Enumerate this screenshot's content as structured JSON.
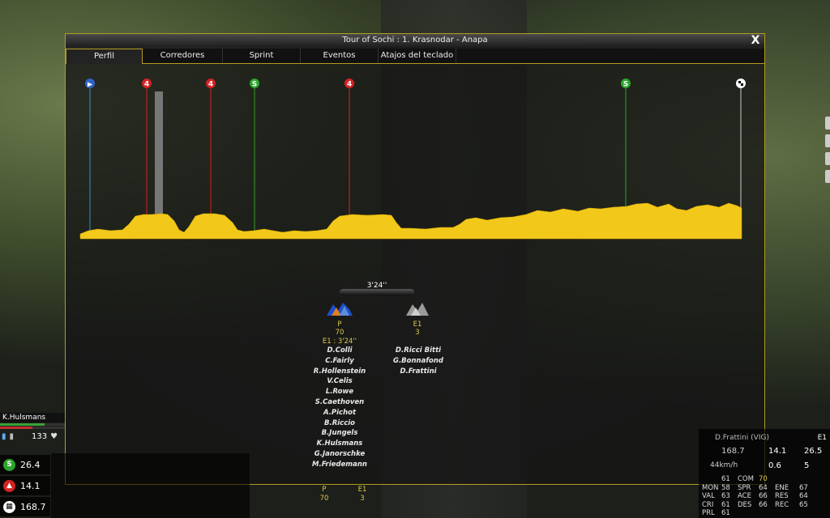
{
  "window": {
    "title": "Tour of Sochi : 1. Krasnodar - Anapa",
    "close_label": "X"
  },
  "tabs": [
    {
      "label": "Perfil",
      "active": true
    },
    {
      "label": "Corredores",
      "active": false
    },
    {
      "label": "Sprint",
      "active": false
    },
    {
      "label": "Eventos",
      "active": false
    },
    {
      "label": "Atajos del teclado",
      "active": false
    }
  ],
  "profile": {
    "markers": [
      {
        "type": "start",
        "icon": "play-icon",
        "color": "#2f63c8",
        "symbol": "▶"
      },
      {
        "type": "climb-cat4",
        "icon": "climb-cat-4-icon",
        "color": "#d42222",
        "symbol": "4"
      },
      {
        "type": "climb-cat4",
        "icon": "climb-cat-4-icon",
        "color": "#d42222",
        "symbol": "4"
      },
      {
        "type": "sprint",
        "icon": "sprint-icon",
        "color": "#2ca52c",
        "symbol": "S"
      },
      {
        "type": "climb-cat4",
        "icon": "climb-cat-4-icon",
        "color": "#d42222",
        "symbol": "4"
      },
      {
        "type": "sprint",
        "icon": "sprint-icon",
        "color": "#2ca52c",
        "symbol": "S"
      },
      {
        "type": "finish",
        "icon": "checkered-flag-icon",
        "color": "#ffffff",
        "symbol": ""
      }
    ],
    "fill_color": "#f2c81a"
  },
  "groups": {
    "gap_label": "3'24''",
    "peloton": {
      "tag": "P",
      "count": "70",
      "gap_text": "E1 : 3'24''",
      "riders": [
        "D.Colli",
        "C.Fairly",
        "R.Hollenstein",
        "V.Celis",
        "L.Rowe",
        "S.Caethoven",
        "A.Pichot",
        "B.Riccio",
        "B.Jungels",
        "K.Hulsmans",
        "G.Janorschke",
        "M.Friedemann"
      ]
    },
    "escape": {
      "tag": "E1",
      "count": "3",
      "riders": [
        "D.Ricci Bitti",
        "G.Bonnafond",
        "D.Frattini"
      ]
    }
  },
  "hud_left": {
    "rider_name": "K.Hulsmans",
    "heart_rate": "133",
    "sprint_value": "26.4",
    "climb_value": "14.1",
    "finish_value": "168.7",
    "mini_tags": {
      "peloton": "P",
      "peloton_count": "70",
      "escape": "E1",
      "escape_count": "3"
    }
  },
  "card": {
    "rider": "D.Frattini (VIG)",
    "group": "E1",
    "distance": "168.7",
    "climb": "14.1",
    "sprint": "26.5",
    "speed": "44km/h",
    "gap_small": "0.6",
    "energy": "5",
    "stats": [
      [
        "",
        "61",
        "COM",
        "70",
        "",
        ""
      ],
      [
        "MON",
        "58",
        "SPR",
        "64",
        "ENE",
        "67"
      ],
      [
        "VAL",
        "63",
        "ACE",
        "66",
        "RES",
        "64"
      ],
      [
        "CRI",
        "61",
        "DES",
        "66",
        "REC",
        "65"
      ],
      [
        "PRL",
        "61",
        "",
        "",
        "",
        ""
      ]
    ]
  }
}
